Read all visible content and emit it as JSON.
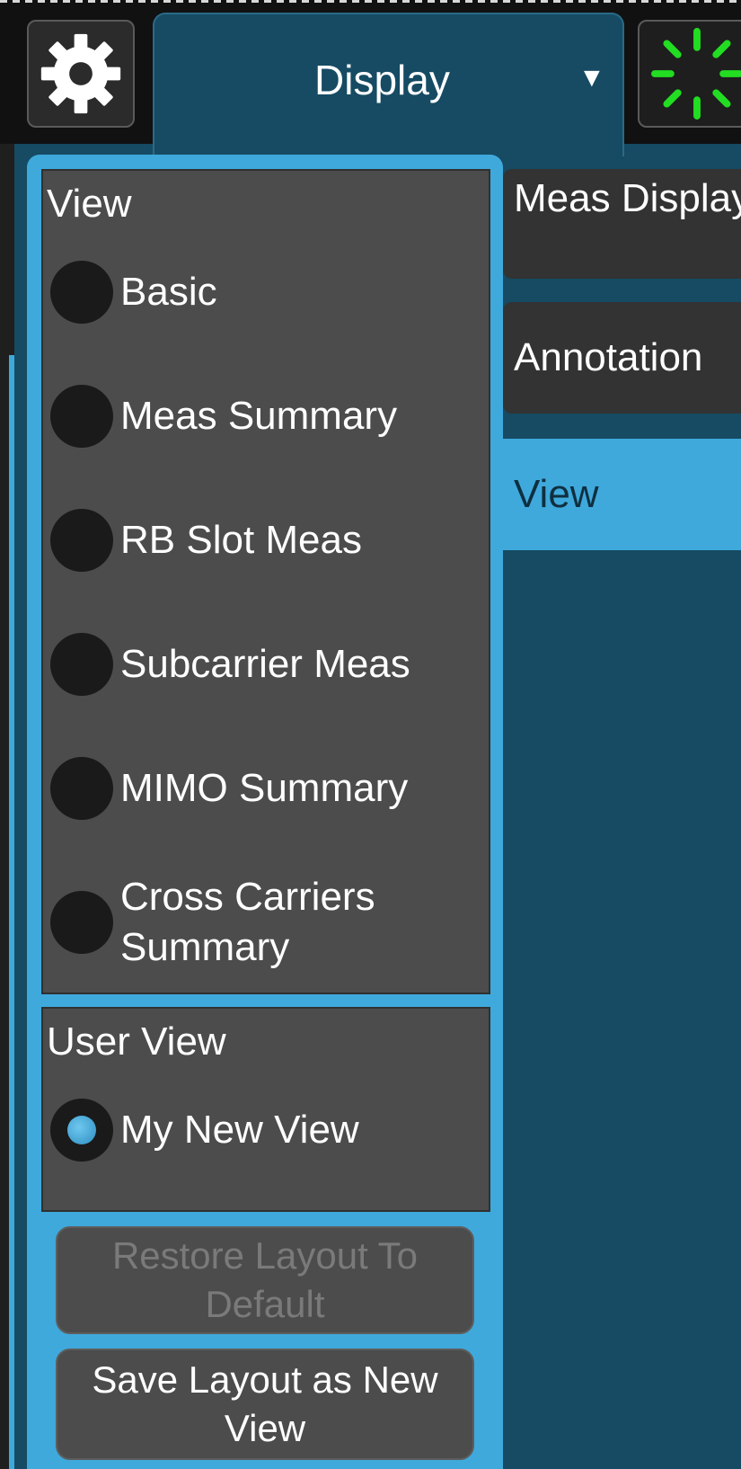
{
  "topbar": {
    "settings_icon": "gear-icon",
    "menu_title": "Display",
    "menu_caret": "▼",
    "busy_icon": "busy-spinner-icon",
    "busy_color": "#22dd22"
  },
  "view_group": {
    "title": "View",
    "options": [
      {
        "label": "Basic",
        "selected": false
      },
      {
        "label": "Meas Summary",
        "selected": false
      },
      {
        "label": "RB Slot Meas",
        "selected": false
      },
      {
        "label": "Subcarrier Meas",
        "selected": false
      },
      {
        "label": "MIMO Summary",
        "selected": false
      },
      {
        "label": "Cross Carriers Summary",
        "selected": false
      }
    ]
  },
  "user_view_group": {
    "title": "User View",
    "options": [
      {
        "label": "My New View",
        "selected": true
      }
    ]
  },
  "buttons": {
    "restore": "Restore Layout To Default",
    "restore_enabled": false,
    "save": "Save Layout as New View"
  },
  "side_tabs": [
    {
      "label": "Meas Display",
      "active": false
    },
    {
      "label": "Annotation",
      "active": false
    },
    {
      "label": "View",
      "active": true
    }
  ],
  "colors": {
    "accent": "#3fa9dc",
    "background": "#164b63",
    "panel": "#4c4c4c"
  }
}
